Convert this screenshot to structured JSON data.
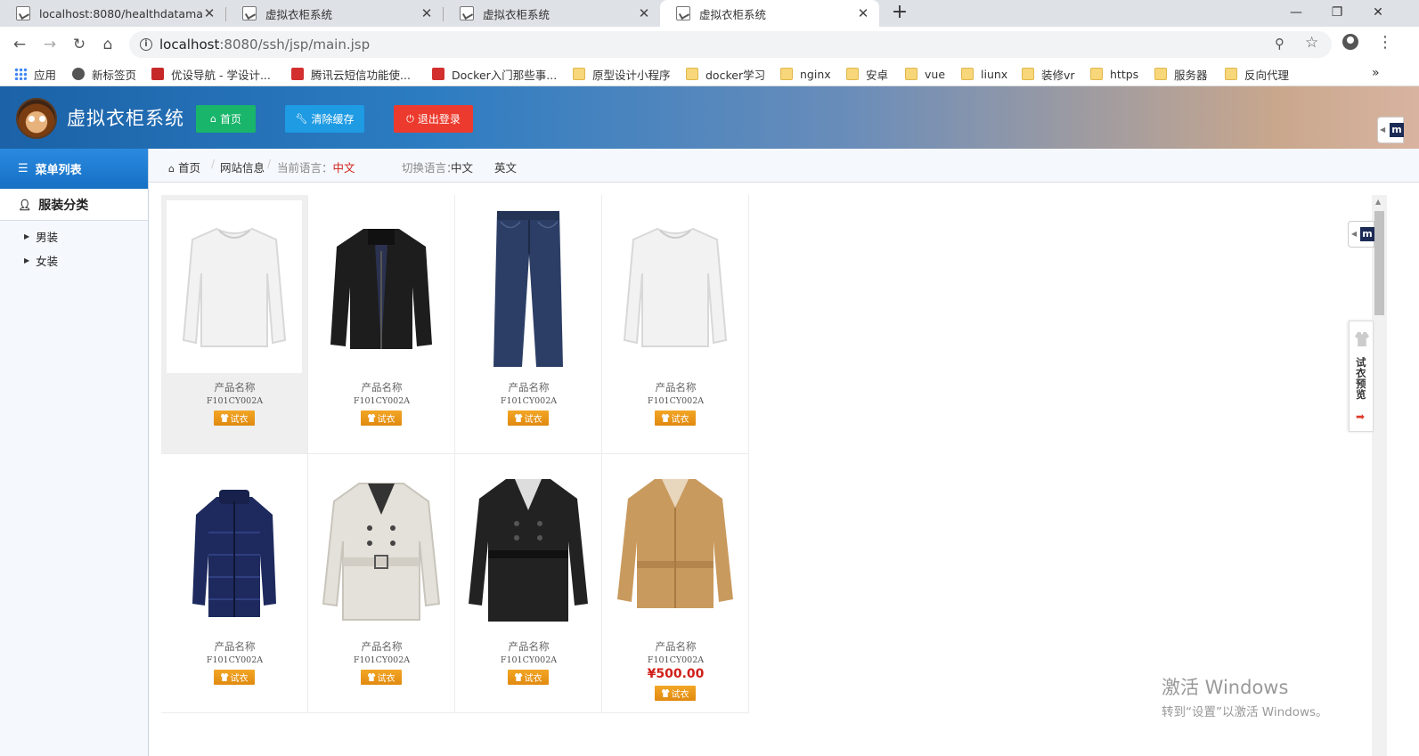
{
  "browser": {
    "tabs": [
      {
        "title": "localhost:8080/healthdataman"
      },
      {
        "title": "虚拟衣柜系统"
      },
      {
        "title": "虚拟衣柜系统"
      },
      {
        "title": "虚拟衣柜系统"
      }
    ],
    "url": {
      "host": "localhost",
      "rest": ":8080/ssh/jsp/main.jsp"
    },
    "bookmarks": [
      {
        "label": "应用",
        "icon": "apps-icon"
      },
      {
        "label": "新标签页",
        "icon": "globe-icon"
      },
      {
        "label": "优设导航 - 学设计...",
        "icon": "youshe-icon"
      },
      {
        "label": "腾讯云短信功能使...",
        "icon": "csdn-icon"
      },
      {
        "label": "Docker入门那些事...",
        "icon": "csdn-icon"
      },
      {
        "label": "原型设计小程序",
        "icon": "folder-icon"
      },
      {
        "label": "docker学习",
        "icon": "folder-icon"
      },
      {
        "label": "nginx",
        "icon": "folder-icon"
      },
      {
        "label": "安卓",
        "icon": "folder-icon"
      },
      {
        "label": "vue",
        "icon": "folder-icon"
      },
      {
        "label": "liunx",
        "icon": "folder-icon"
      },
      {
        "label": "装修vr",
        "icon": "folder-icon"
      },
      {
        "label": "https",
        "icon": "folder-icon"
      },
      {
        "label": "服务器",
        "icon": "folder-icon"
      },
      {
        "label": "反向代理",
        "icon": "folder-icon"
      }
    ],
    "bookmarks_more": "»"
  },
  "header": {
    "title": "虚拟衣柜系统",
    "home_label": "首页",
    "clear_cache_label": "清除缓存",
    "logout_label": "退出登录",
    "side_badge": "m"
  },
  "sidebar": {
    "menu_title": "菜单列表",
    "group": "服装分类",
    "items": [
      {
        "label": "男装"
      },
      {
        "label": "女装"
      }
    ]
  },
  "breadcrumb": {
    "home": "首页",
    "site_info": "网站信息",
    "current_lang_label": "当前语言：",
    "current_lang": "中文",
    "switch_lang_label": "切换语言：",
    "lang_zh": "中文",
    "lang_en": "英文"
  },
  "products": [
    {
      "name": "产品名称",
      "code": "F101CY002A",
      "try": "试衣",
      "image": "white-longsleeve-shirt",
      "price": ""
    },
    {
      "name": "产品名称",
      "code": "F101CY002A",
      "try": "试衣",
      "image": "black-leather-jacket",
      "price": ""
    },
    {
      "name": "产品名称",
      "code": "F101CY002A",
      "try": "试衣",
      "image": "blue-jeans",
      "price": ""
    },
    {
      "name": "产品名称",
      "code": "F101CY002A",
      "try": "试衣",
      "image": "white-longsleeve-shirt",
      "price": ""
    },
    {
      "name": "产品名称",
      "code": "F101CY002A",
      "try": "试衣",
      "image": "navy-down-jacket",
      "price": ""
    },
    {
      "name": "产品名称",
      "code": "F101CY002A",
      "try": "试衣",
      "image": "white-trench-coat",
      "price": ""
    },
    {
      "name": "产品名称",
      "code": "F101CY002A",
      "try": "试衣",
      "image": "black-trench-coat",
      "price": ""
    },
    {
      "name": "产品名称",
      "code": "F101CY002A",
      "try": "试衣",
      "image": "tan-trench-coat",
      "price": "¥500.00"
    }
  ],
  "preview_widget": {
    "label": "试衣预览"
  },
  "watermark": {
    "line1": "激活 Windows",
    "line2": "转到“设置”以激活 Windows。"
  }
}
